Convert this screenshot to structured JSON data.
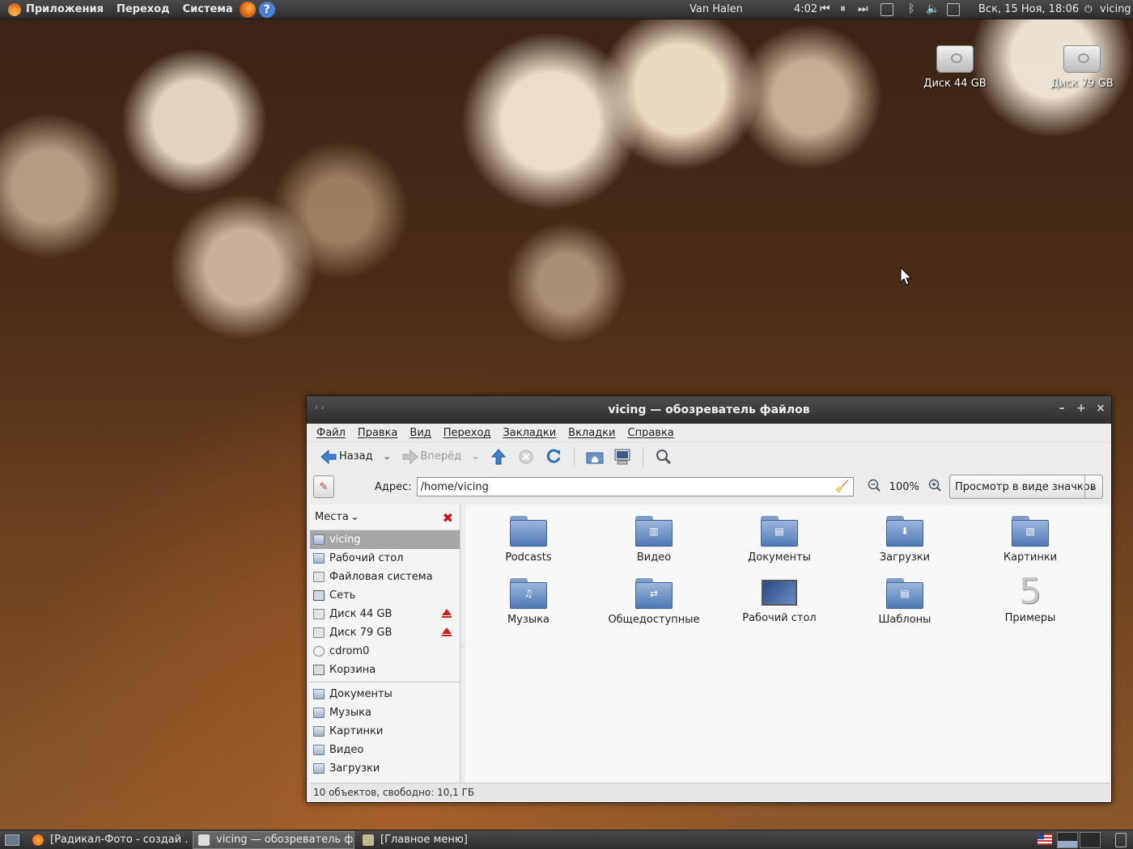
{
  "top_panel": {
    "menus": [
      "Приложения",
      "Переход",
      "Система"
    ],
    "now_playing": "Van Halen",
    "track_time": "4:02",
    "datetime": "Вск, 15 Ноя, 18:06",
    "user": "vicing"
  },
  "desktop": {
    "icons": [
      {
        "label": "Диск 44 GB"
      },
      {
        "label": "Диск 79 GB"
      }
    ]
  },
  "window": {
    "title": "vicing — обозреватель файлов",
    "menu": [
      "Файл",
      "Правка",
      "Вид",
      "Переход",
      "Закладки",
      "Вкладки",
      "Справка"
    ],
    "toolbar": {
      "back": "Назад",
      "forward": "Вперёд"
    },
    "address": {
      "label": "Адрес:",
      "value": "/home/vicing",
      "zoom": "100%",
      "view_mode": "Просмотр в виде значков"
    },
    "sidebar": {
      "header": "Места",
      "places": [
        {
          "label": "vicing"
        },
        {
          "label": "Рабочий стол"
        },
        {
          "label": "Файловая система"
        },
        {
          "label": "Сеть"
        },
        {
          "label": "Диск 44 GB"
        },
        {
          "label": "Диск 79 GB"
        },
        {
          "label": "cdrom0"
        },
        {
          "label": "Корзина"
        }
      ],
      "bookmarks": [
        {
          "label": "Документы"
        },
        {
          "label": "Музыка"
        },
        {
          "label": "Картинки"
        },
        {
          "label": "Видео"
        },
        {
          "label": "Загрузки"
        }
      ]
    },
    "files": [
      {
        "label": "Podcasts",
        "icon": "folder"
      },
      {
        "label": "Видео",
        "icon": "folder-video"
      },
      {
        "label": "Документы",
        "icon": "folder-documents"
      },
      {
        "label": "Загрузки",
        "icon": "folder-download"
      },
      {
        "label": "Картинки",
        "icon": "folder-pictures"
      },
      {
        "label": "Музыка",
        "icon": "folder-music"
      },
      {
        "label": "Общедоступные",
        "icon": "folder-public"
      },
      {
        "label": "Рабочий стол",
        "icon": "desktop"
      },
      {
        "label": "Шаблоны",
        "icon": "folder-templates"
      },
      {
        "label": "Примеры",
        "icon": "examples"
      }
    ],
    "status": "10 объектов, свободно: 10,1 ГБ"
  },
  "taskbar": {
    "tasks": [
      {
        "label": "[Радикал-Фото - создай ..."
      },
      {
        "label": "vicing — обозреватель ф..."
      },
      {
        "label": "[Главное меню]"
      }
    ]
  }
}
